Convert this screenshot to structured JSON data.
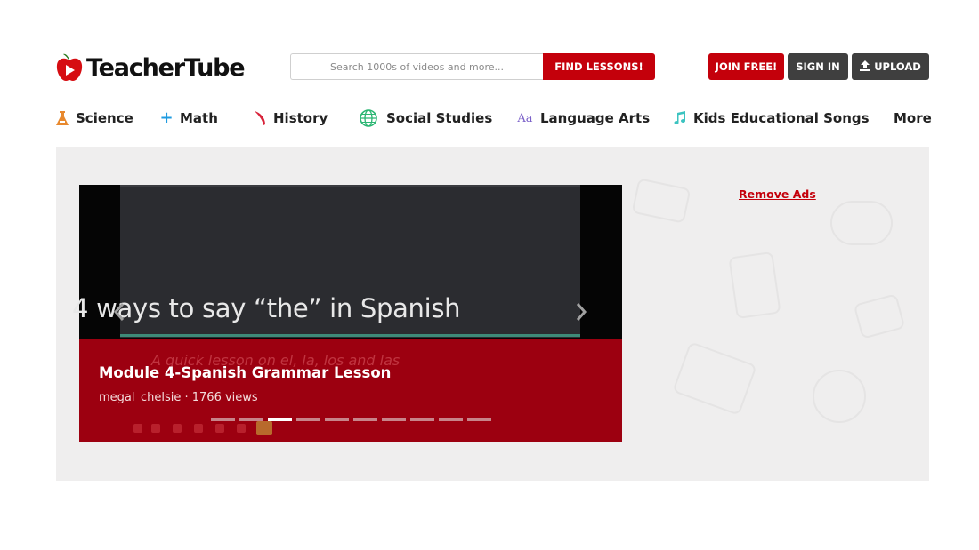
{
  "brand": {
    "name": "TeacherTube"
  },
  "search": {
    "placeholder": "Search 1000s of videos and more...",
    "value": "",
    "button_label": "FIND LESSONS!"
  },
  "header_buttons": {
    "join": "JOIN FREE!",
    "signin": "SIGN IN",
    "upload": "UPLOAD"
  },
  "nav": {
    "items": [
      {
        "label": "Science",
        "icon": "flask-icon",
        "color": "#e8892e"
      },
      {
        "label": "Math",
        "icon": "plus-icon",
        "color": "#1f9be0"
      },
      {
        "label": "History",
        "icon": "quill-icon",
        "color": "#d8233a"
      },
      {
        "label": "Social Studies",
        "icon": "globe-icon",
        "color": "#2bb673"
      },
      {
        "label": "Language Arts",
        "icon": "letters-icon",
        "color": "#7b61c9"
      },
      {
        "label": "Kids Educational Songs",
        "icon": "music-note-icon",
        "color": "#3cc3c0"
      },
      {
        "label": "More",
        "icon": "",
        "color": ""
      }
    ]
  },
  "carousel": {
    "video_frame_title": "4 ways to say “the” in Spanish",
    "video_frame_subtitle": "A quick lesson on el, la, los and las",
    "caption_title": "Module 4-Spanish Grammar Lesson",
    "caption_meta": "megal_chelsie · 1766 views",
    "prev_icon": "chevron-left-icon",
    "next_icon": "chevron-right-icon",
    "slide_count": 10,
    "active_slide": 3
  },
  "sidebar": {
    "remove_ads_label": "Remove Ads"
  },
  "colors": {
    "brand_red": "#c4000b",
    "dark_button": "#3f3f3f",
    "caption_band": "#9c0010"
  }
}
